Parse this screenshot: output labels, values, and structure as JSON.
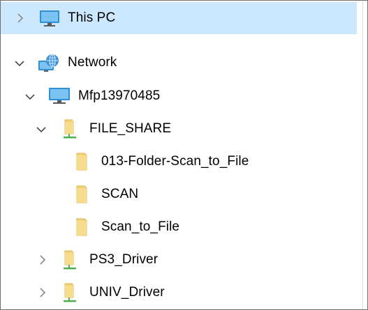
{
  "tree": {
    "this_pc": {
      "label": "This PC",
      "icon": "monitor-icon",
      "expanded": false,
      "selected": true
    },
    "network": {
      "label": "Network",
      "icon": "network-globe-icon",
      "expanded": true
    },
    "mfp": {
      "label": "Mfp13970485",
      "icon": "computer-icon",
      "expanded": true
    },
    "file_share": {
      "label": "FILE_SHARE",
      "icon": "shared-folder-icon",
      "expanded": true
    },
    "folders": [
      {
        "label": "013-Folder-Scan_to_File",
        "icon": "folder-icon"
      },
      {
        "label": "SCAN",
        "icon": "folder-icon"
      },
      {
        "label": "Scan_to_File",
        "icon": "folder-icon"
      }
    ],
    "ps3_driver": {
      "label": "PS3_Driver",
      "icon": "shared-folder-icon",
      "expanded": false
    },
    "univ_driver": {
      "label": "UNIV_Driver",
      "icon": "shared-folder-icon",
      "expanded": false
    }
  },
  "colors": {
    "selection": "#cce8ff",
    "folder": "#f3d17a",
    "folder_dark": "#e0b54c",
    "share_bar": "#4caf50",
    "monitor": "#2d8fd8",
    "chevron": "#707070"
  }
}
